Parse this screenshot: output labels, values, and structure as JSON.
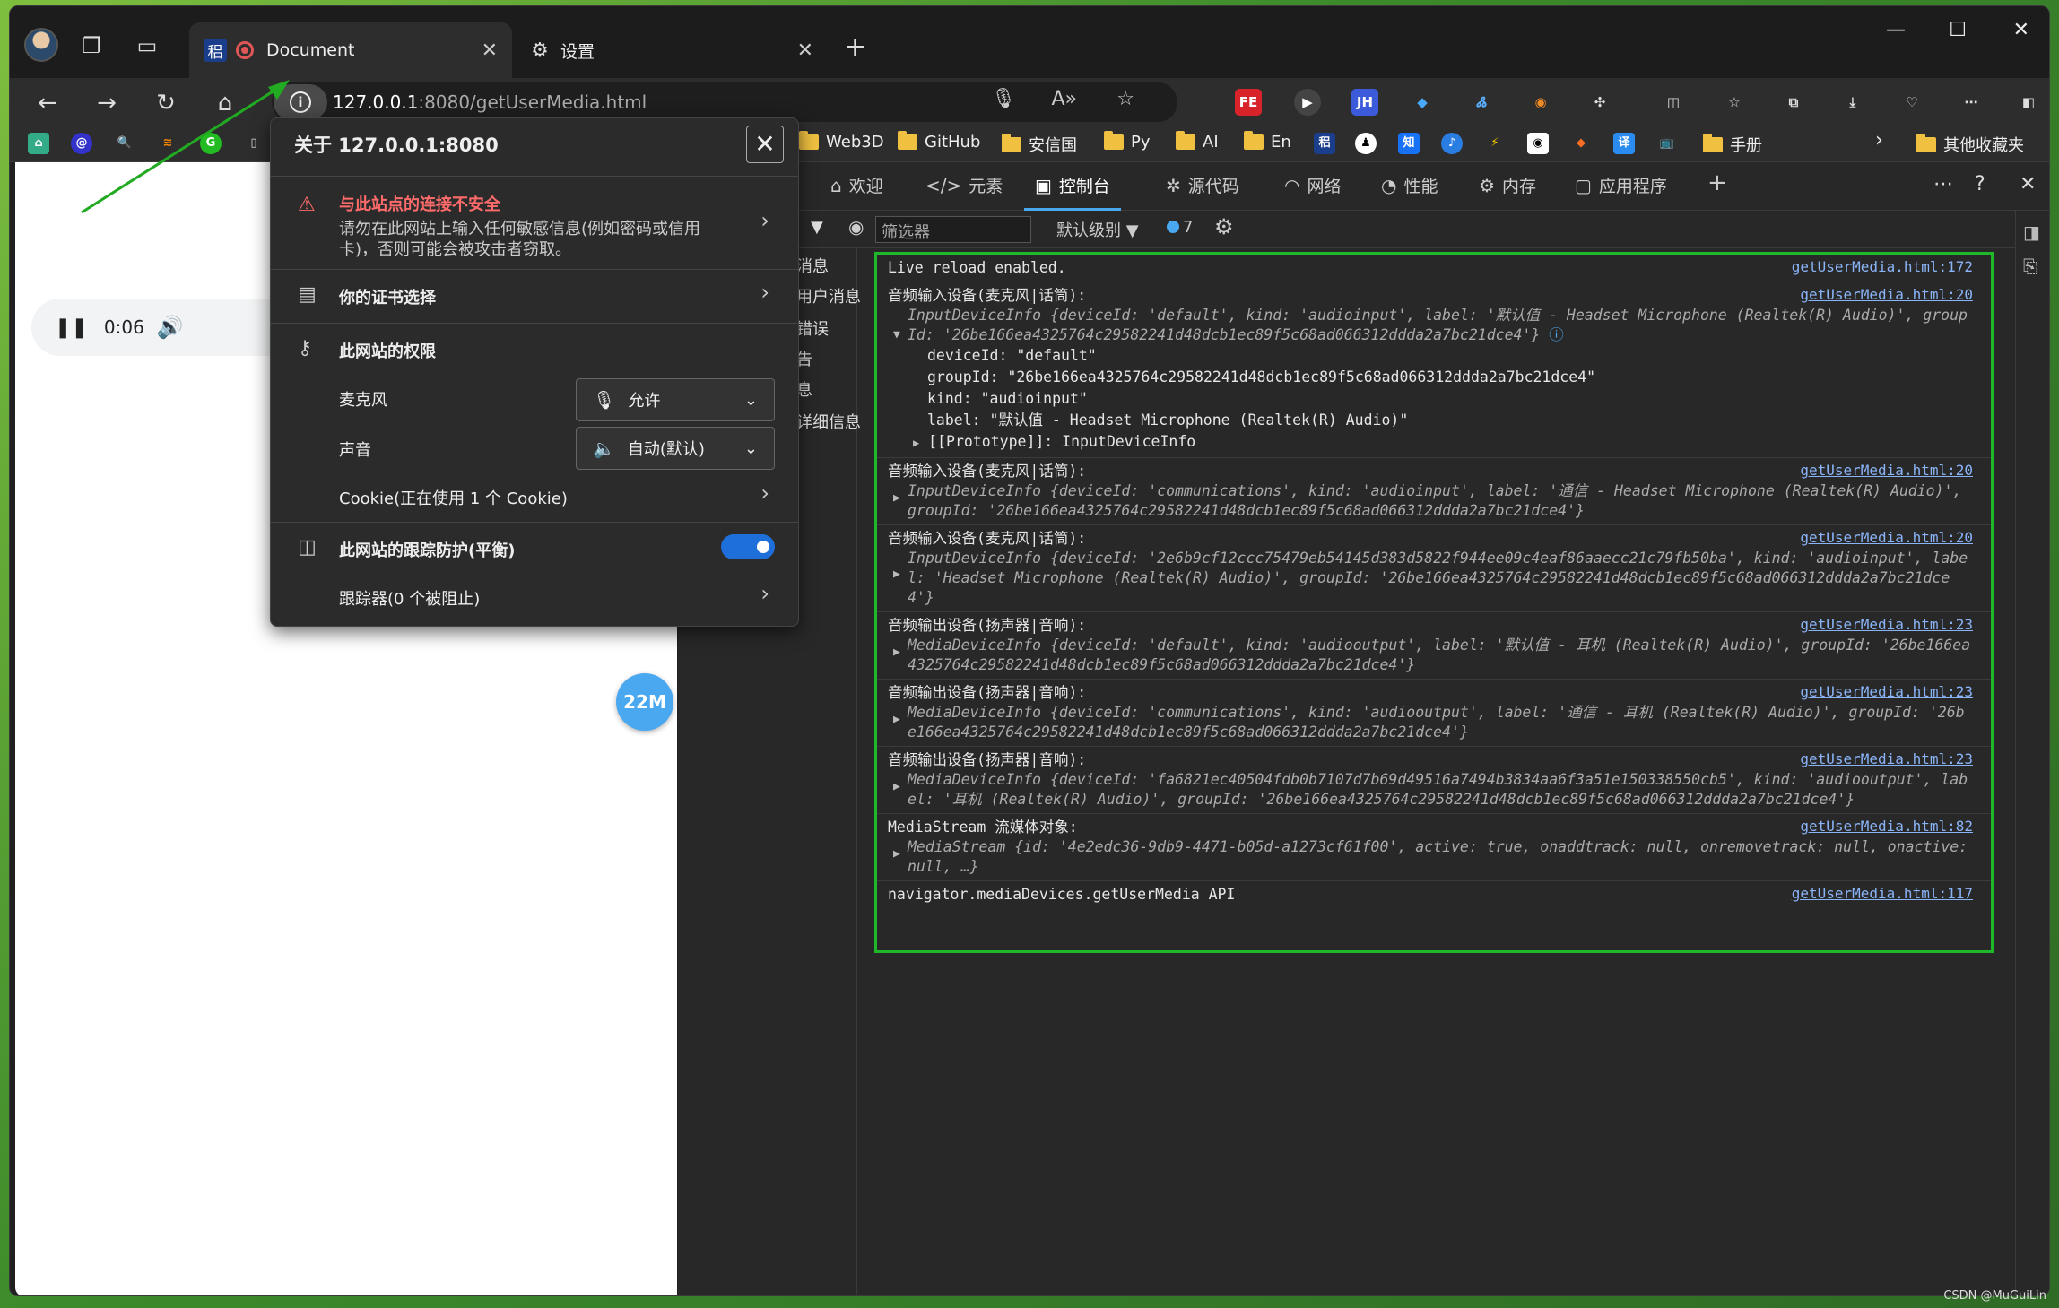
{
  "tabs": {
    "active": {
      "fav_text": "稆",
      "title": "Document"
    },
    "settings": {
      "title": "设置"
    }
  },
  "address": {
    "host": "127.0.0.1",
    "path": ":8080/getUserMedia.html"
  },
  "bookmarks": [
    {
      "label": "Web3D"
    },
    {
      "label": "GitHub"
    },
    {
      "label": "安信国"
    },
    {
      "label": "Py"
    },
    {
      "label": "AI"
    },
    {
      "label": "En"
    },
    {
      "label": "手册"
    },
    {
      "label": "其他收藏夹"
    }
  ],
  "page": {
    "audio_time": "0:06",
    "badge": "22M"
  },
  "popup": {
    "title": "关于 127.0.0.1:8080",
    "warning_title": "与此站点的连接不安全",
    "warning_line1": "请勿在此网站上输入任何敏感信息(例如密码或信用",
    "warning_line2": "卡)，否则可能会被攻击者窃取。",
    "cert": "你的证书选择",
    "permissions": "此网站的权限",
    "mic_label": "麦克风",
    "mic_value": "允许",
    "sound_label": "声音",
    "sound_value": "自动(默认)",
    "cookie": "Cookie(正在使用 1 个 Cookie)",
    "tracking": "此网站的跟踪防护(平衡)",
    "trackers": "跟踪器(0 个被阻止)"
  },
  "devtools": {
    "tabs": [
      "欢迎",
      "元素",
      "控制台",
      "源代码",
      "网络",
      "性能",
      "内存",
      "应用程序"
    ],
    "filter_placeholder": "筛选器",
    "levels": "默认级别",
    "count": "7",
    "sidebar": [
      "消息",
      "用户消息",
      "错误",
      "告",
      "息",
      "详细信息"
    ]
  },
  "console": {
    "live": {
      "text": "Live reload enabled.",
      "src": "getUserMedia.html:172"
    },
    "in_label": "音频输入设备(麦克风|话筒):",
    "out_label": "音频输出设备(扬声器|音响):",
    "src20": "getUserMedia.html:20",
    "src23": "getUserMedia.html:23",
    "entry1": {
      "obj": "InputDeviceInfo {deviceId: 'default', kind: 'audioinput', label: '默认值 - Headset Microphone (Realtek(R) Audio)', groupId: '26be166ea4325764c29582241d48dcb1ec89f5c68ad066312ddda2a7bc21dce4'}",
      "deviceId": "deviceId: \"default\"",
      "groupId": "groupId: \"26be166ea4325764c29582241d48dcb1ec89f5c68ad066312ddda2a7bc21dce4\"",
      "kind": "kind: \"audioinput\"",
      "label": "label: \"默认值 - Headset Microphone (Realtek(R) Audio)\"",
      "proto": "[[Prototype]]: InputDeviceInfo"
    },
    "entry2": "InputDeviceInfo {deviceId: 'communications', kind: 'audioinput', label: '通信 - Headset Microphone (Realtek(R) Audio)', groupId: '26be166ea4325764c29582241d48dcb1ec89f5c68ad066312ddda2a7bc21dce4'}",
    "entry3": "InputDeviceInfo {deviceId: '2e6b9cf12ccc75479eb54145d383d5822f944ee09c4eaf86aaecc21c79fb50ba', kind: 'audioinput', label: 'Headset Microphone (Realtek(R) Audio)', groupId: '26be166ea4325764c29582241d48dcb1ec89f5c68ad066312ddda2a7bc21dce4'}",
    "entry4": "MediaDeviceInfo {deviceId: 'default', kind: 'audiooutput', label: '默认值 - 耳机 (Realtek(R) Audio)', groupId: '26be166ea4325764c29582241d48dcb1ec89f5c68ad066312ddda2a7bc21dce4'}",
    "entry5": "MediaDeviceInfo {deviceId: 'communications', kind: 'audiooutput', label: '通信 - 耳机 (Realtek(R) Audio)', groupId: '26be166ea4325764c29582241d48dcb1ec89f5c68ad066312ddda2a7bc21dce4'}",
    "entry6": "MediaDeviceInfo {deviceId: 'fa6821ec40504fdb0b7107d7b69d49516a7494b3834aa6f3a51e150338550cb5', kind: 'audiooutput', label: '耳机 (Realtek(R) Audio)', groupId: '26be166ea4325764c29582241d48dcb1ec89f5c68ad066312ddda2a7bc21dce4'}",
    "stream_label": "MediaStream 流媒体对象:",
    "src82": "getUserMedia.html:82",
    "entry7": "MediaStream {id: '4e2edc36-9db9-4471-b05d-a1273cf61f00', active: true, onaddtrack: null, onremovetrack: null, onactive: null, …}",
    "api": {
      "text": "navigator.mediaDevices.getUserMedia API",
      "src": "getUserMedia.html:117"
    }
  },
  "watermark": "CSDN @MuGuiLin"
}
